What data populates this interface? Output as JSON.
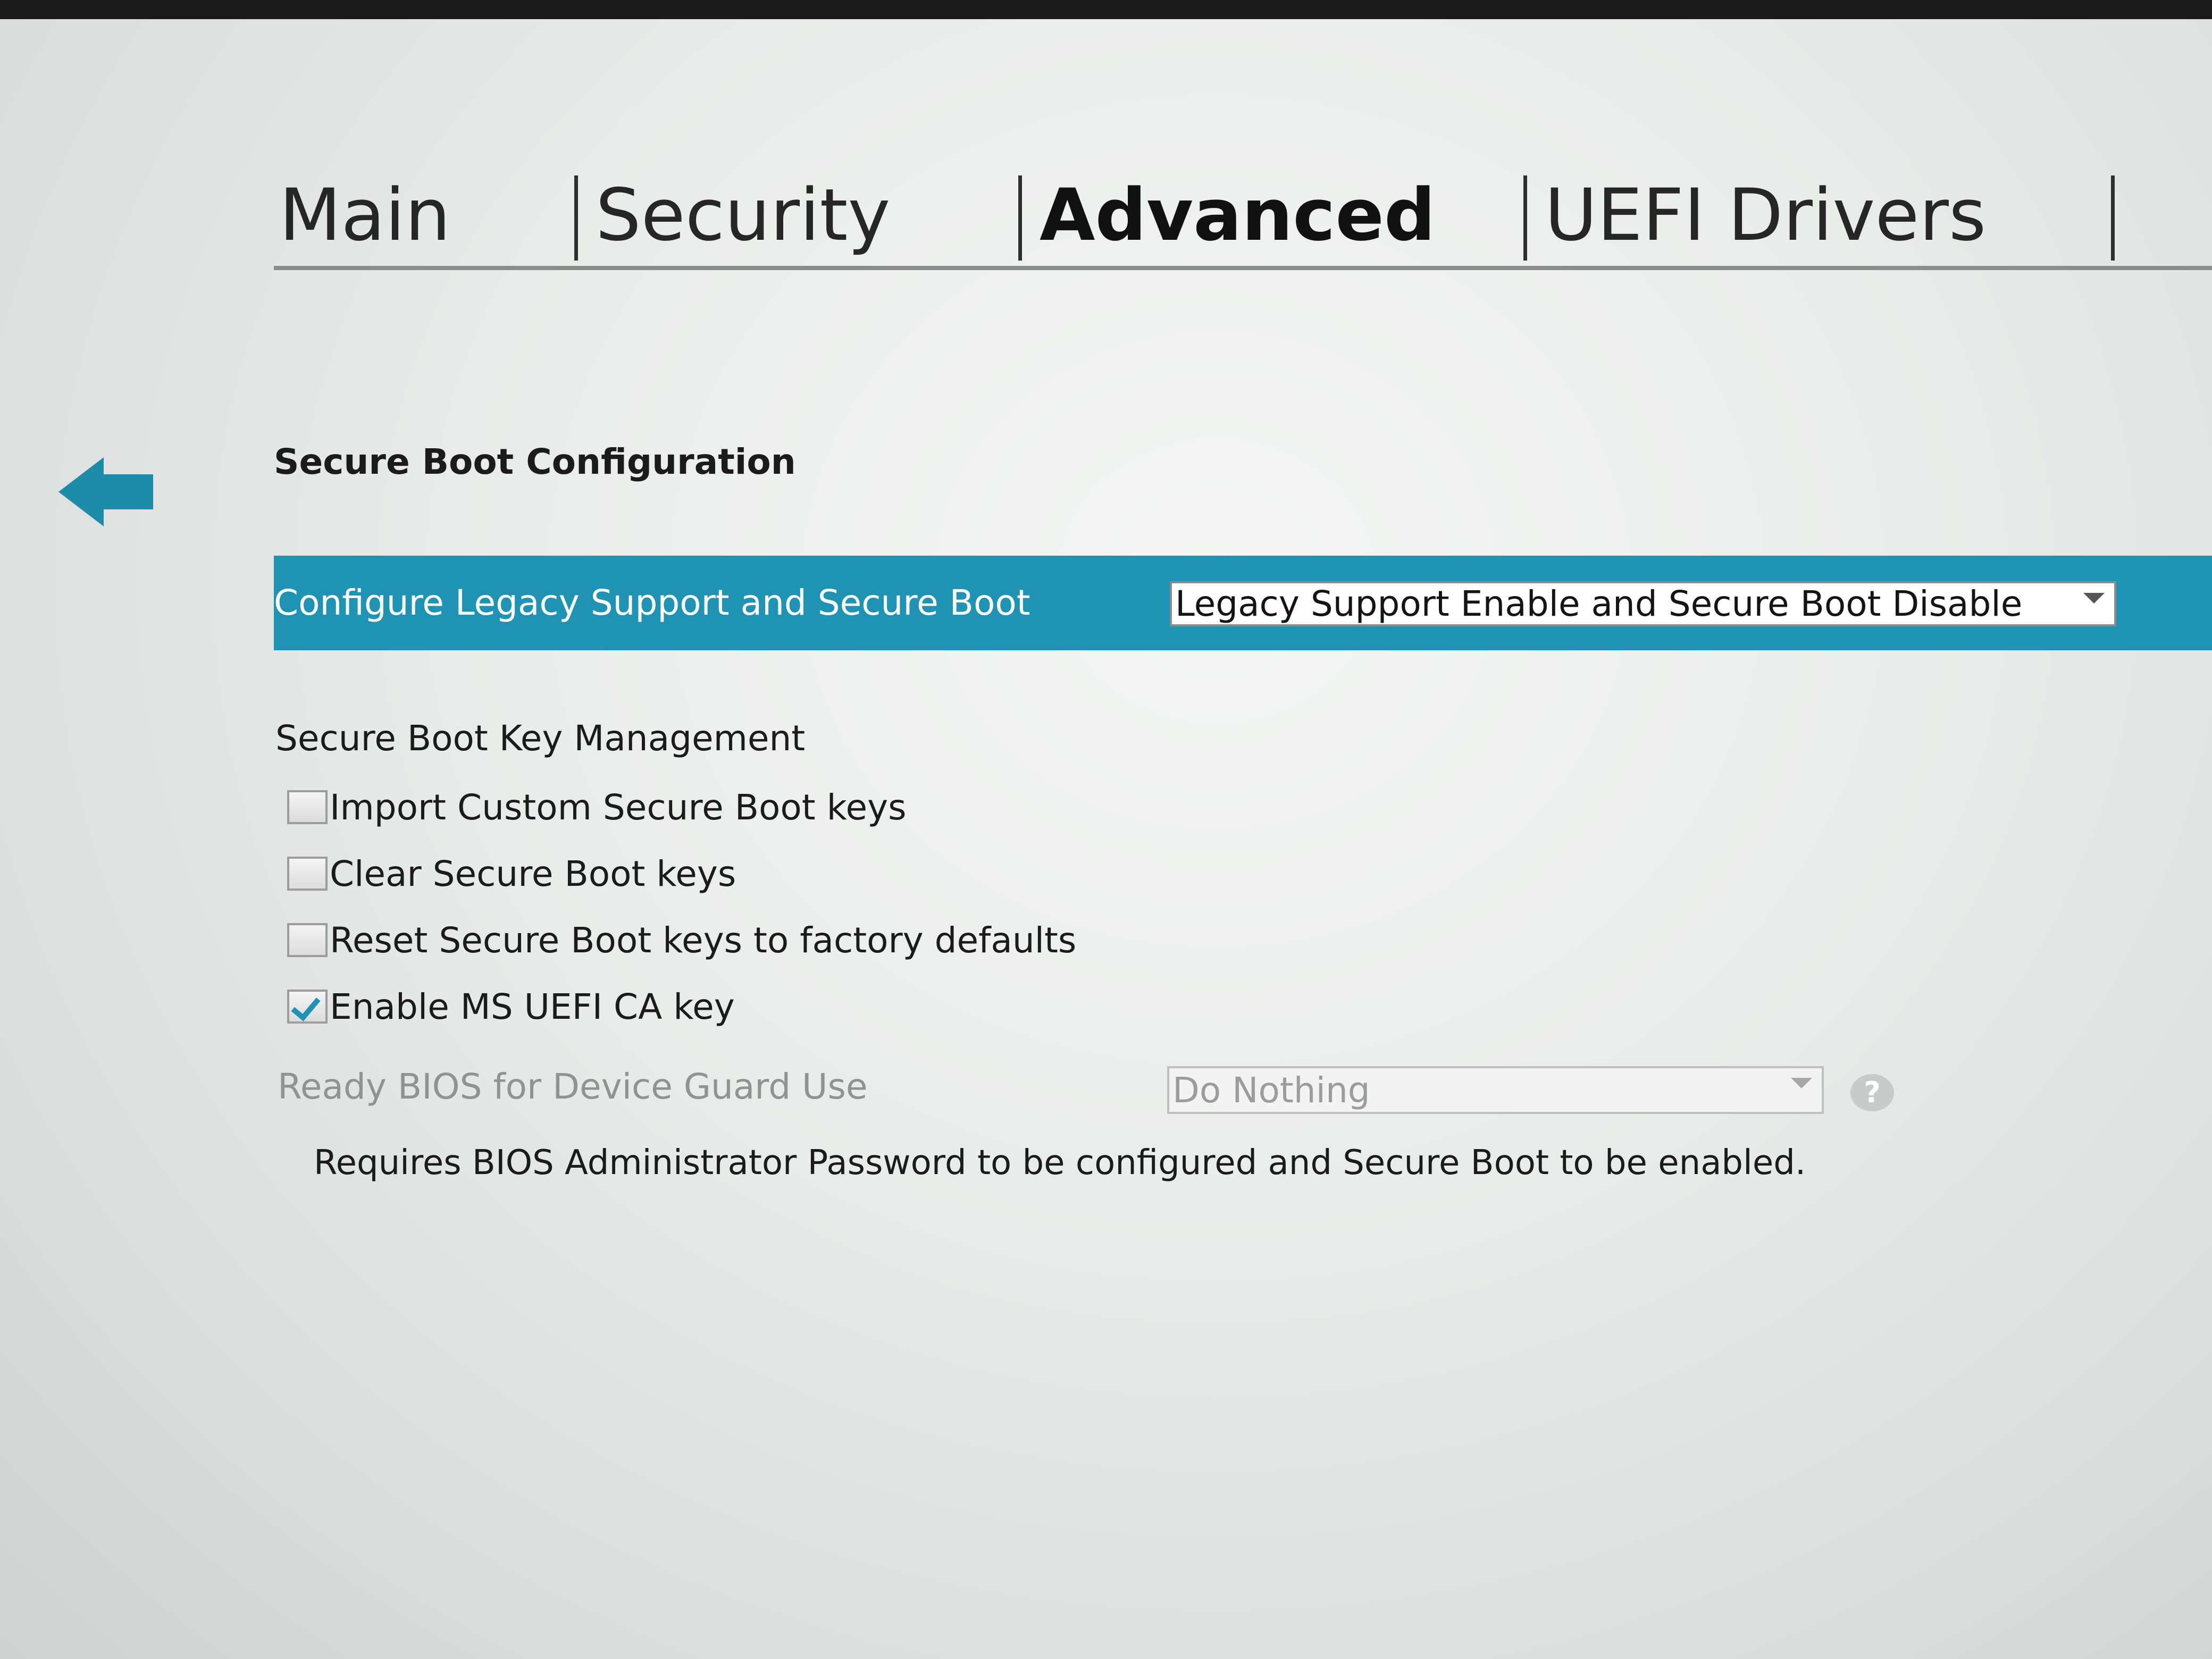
{
  "tabs": [
    {
      "label": "Main",
      "active": false
    },
    {
      "label": "Security",
      "active": false
    },
    {
      "label": "Advanced",
      "active": true
    },
    {
      "label": "UEFI Drivers",
      "active": false
    }
  ],
  "page": {
    "back_icon": "back-arrow-icon",
    "title": "Secure Boot Configuration"
  },
  "legacy": {
    "label": "Configure Legacy Support and Secure Boot",
    "value": "Legacy Support Enable and Secure Boot Disable"
  },
  "key_management": {
    "title": "Secure Boot Key Management",
    "options": [
      {
        "label": "Import Custom Secure Boot keys",
        "checked": false
      },
      {
        "label": "Clear Secure Boot keys",
        "checked": false
      },
      {
        "label": "Reset Secure Boot keys to factory defaults",
        "checked": false
      },
      {
        "label": "Enable MS UEFI CA key",
        "checked": true
      }
    ]
  },
  "device_guard": {
    "label": "Ready BIOS for Device Guard Use",
    "value": "Do Nothing",
    "help_icon": "help-icon",
    "note": "Requires BIOS Administrator Password to be configured and Secure Boot to be enabled."
  },
  "colors": {
    "accent": "#1f93b3",
    "back_arrow": "#1c8ca8",
    "background": "#e9ebea"
  }
}
